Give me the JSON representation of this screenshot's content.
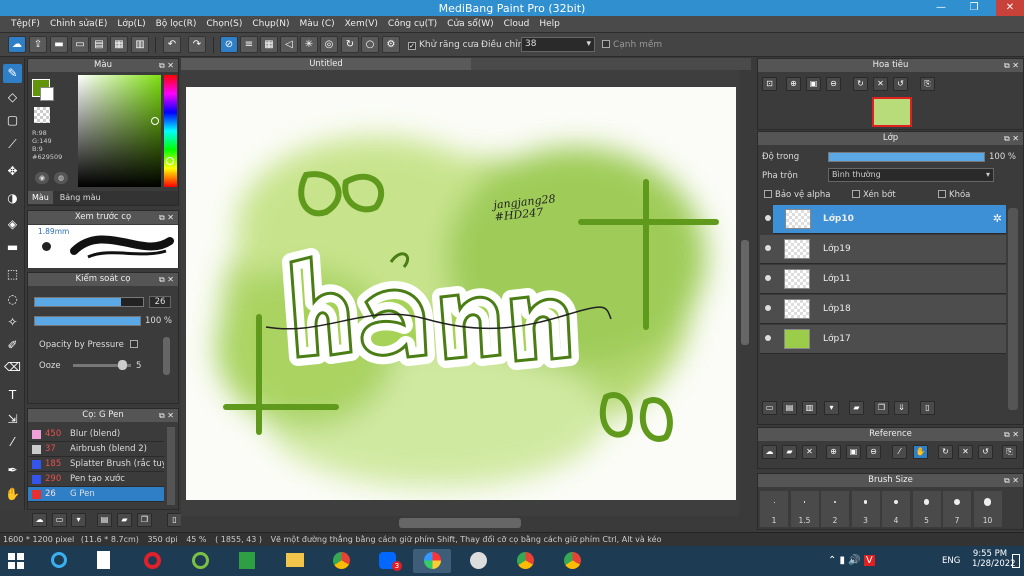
{
  "window": {
    "title": "MediBang Paint Pro (32bit)",
    "min": "—",
    "max": "❐",
    "close": "✕"
  },
  "menu": [
    "Tệp(F)",
    "Chỉnh sửa(E)",
    "Lớp(L)",
    "Bộ lọc(R)",
    "Chọn(S)",
    "Chụp(N)",
    "Màu (C)",
    "Xem(V)",
    "Công cụ(T)",
    "Cửa sổ(W)",
    "Cloud",
    "Help"
  ],
  "toolbar": {
    "antialias": "Khử răng cưa",
    "correction_label": "Điều chỉnh",
    "correction_value": "38",
    "snap": "Cạnh mềm"
  },
  "color_panel": {
    "title": "Màu",
    "rgb": [
      "R:98",
      "G:149",
      "B:9"
    ],
    "hex": "#629509",
    "tab_color": "Màu",
    "tab_palette": "Bảng màu",
    "color": "#629509"
  },
  "brush_preview": {
    "title": "Xem trước cọ",
    "size": "1.89mm"
  },
  "brush_control": {
    "title": "Kiểm soát cọ",
    "size": "26",
    "opacity": "100 %",
    "size_fill": 0.8,
    "opacity_fill": 1.0,
    "pressure": "Opacity by Pressure",
    "ooze": "Ooze",
    "ooze_value": "5",
    "ooze_fill": 0.9
  },
  "brush_list": {
    "title": "Cọ: G Pen",
    "items": [
      {
        "size": "450",
        "name": "Blur (blend)",
        "color": "#f0a0d8"
      },
      {
        "size": "37",
        "name": "Airbrush (blend 2)",
        "color": "#cccccc"
      },
      {
        "size": "185",
        "name": "Splatter Brush (rắc tuyết)",
        "color": "#3355ee"
      },
      {
        "size": "290",
        "name": "Pen tạo xước",
        "color": "#3355ee"
      },
      {
        "size": "26",
        "name": "G Pen",
        "color": "#e83030"
      }
    ]
  },
  "document": {
    "tab": "Untitled",
    "artist_text": "jangjang28 #HD247"
  },
  "navigator": {
    "title": "Hoa tiêu"
  },
  "layers": {
    "title": "Lớp",
    "opacity_label": "Độ trong",
    "opacity_value": "100 %",
    "opacity_fill": 1.0,
    "blend_label": "Pha trộn",
    "blend_value": "Bình thường",
    "protect_alpha": "Bảo vệ alpha",
    "clipping": "Xén bớt",
    "lock": "Khóa",
    "items": [
      {
        "name": "Lớp10"
      },
      {
        "name": "Lớp19"
      },
      {
        "name": "Lớp11"
      },
      {
        "name": "Lớp18"
      },
      {
        "name": "Lớp17"
      }
    ]
  },
  "reference": {
    "title": "Reference"
  },
  "brush_size": {
    "title": "Brush Size",
    "sizes": [
      "1",
      "1.5",
      "2",
      "3",
      "4",
      "5",
      "7",
      "10"
    ]
  },
  "status": {
    "dims": "1600 * 1200 pixel",
    "cm": "(11.6 * 8.7cm)",
    "dpi": "350 dpi",
    "zoom": "45 %",
    "coords": "( 1855, 43 )",
    "hint": "Vẽ một đường thẳng bằng cách giữ phím Shift, Thay đổi cỡ cọ bằng cách giữ phím Ctrl, Alt và kéo"
  },
  "taskbar": {
    "lang": "ENG",
    "time": "9:55 PM",
    "date": "1/28/2022",
    "zalo_badge": "3"
  }
}
